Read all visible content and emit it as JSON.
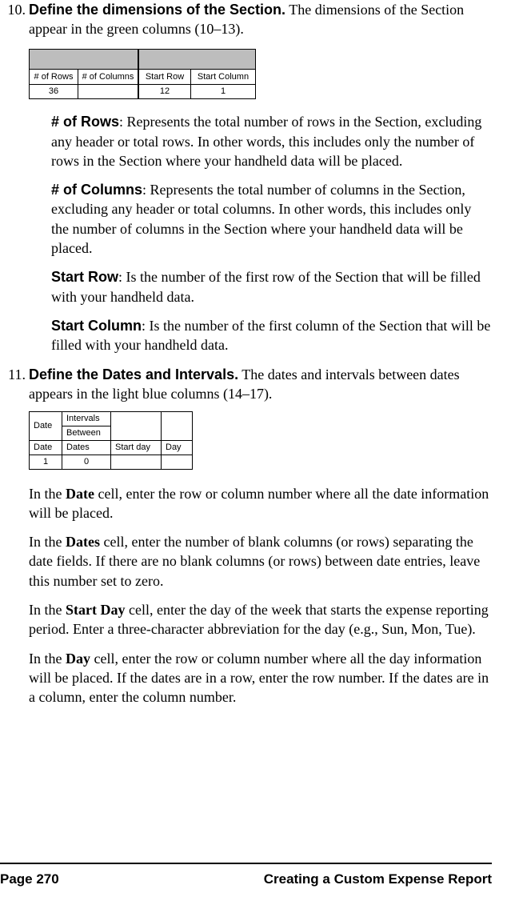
{
  "items": {
    "i10": {
      "num": "10.",
      "title": "Define the dimensions of the Section.",
      "text": " The dimensions of the Section appear in the green columns (10–13)."
    },
    "i11": {
      "num": "11.",
      "title": "Define the Dates and Intervals.",
      "text": " The dates and intervals between dates appears in the light blue columns (14–17)."
    }
  },
  "table1": {
    "headers": {
      "c1": "# of Rows",
      "c2": "# of Columns",
      "c3": "Start Row",
      "c4": "Start Column"
    },
    "values": {
      "c1": "36",
      "c2": "",
      "c3": "12",
      "c4": "1"
    }
  },
  "defs": {
    "rows": {
      "label": "# of Rows",
      "text": ": Represents the total number of rows in the Section, excluding any header or total rows. In other words, this includes only the number of rows in the Section where your handheld data will be placed."
    },
    "cols": {
      "label": "# of Columns",
      "text": ": Represents the total number of columns in the Section, excluding any header or total columns. In other words, this includes only the number of columns in the Section where your handheld data will be placed."
    },
    "srow": {
      "label": "Start Row",
      "text": ": Is the number of the first row of the Section that will be filled with your handheld data."
    },
    "scol": {
      "label": "Start Column",
      "text": ": Is the number of the first column of the Section that will be filled with your handheld data."
    }
  },
  "table2": {
    "r1": {
      "c1": "Date",
      "c2": "Intervals",
      "c3": "",
      "c4": ""
    },
    "r2": {
      "c1": "",
      "c2": "Between",
      "c3": "",
      "c4": ""
    },
    "r3": {
      "c1": "Date",
      "c2": "Dates",
      "c3": "Start day",
      "c4": "Day"
    },
    "vals": {
      "c1": "1",
      "c2": "0",
      "c3": "",
      "c4": ""
    }
  },
  "paras": {
    "p1": {
      "pre": "In the ",
      "bold": "Date",
      "post": " cell, enter the row or column number where all the date information will be placed."
    },
    "p2": {
      "pre": "In the ",
      "bold": "Dates",
      "post": " cell, enter the number of blank columns (or rows) separating the date fields. If there are no blank columns (or rows) between date entries, leave this number set to zero."
    },
    "p3": {
      "pre": "In the ",
      "bold": "Start Day",
      "post": " cell, enter the day of the week that starts the expense reporting period. Enter a three-character abbreviation for the day (e.g., Sun, Mon, Tue)."
    },
    "p4": {
      "pre": "In the ",
      "bold": "Day",
      "post": " cell, enter the row or column number where all the day information will be placed. If the dates are in a row, enter the row number. If the dates are in a column, enter the column number."
    }
  },
  "footer": {
    "left": "Page 270",
    "right": "Creating a Custom Expense Report"
  }
}
